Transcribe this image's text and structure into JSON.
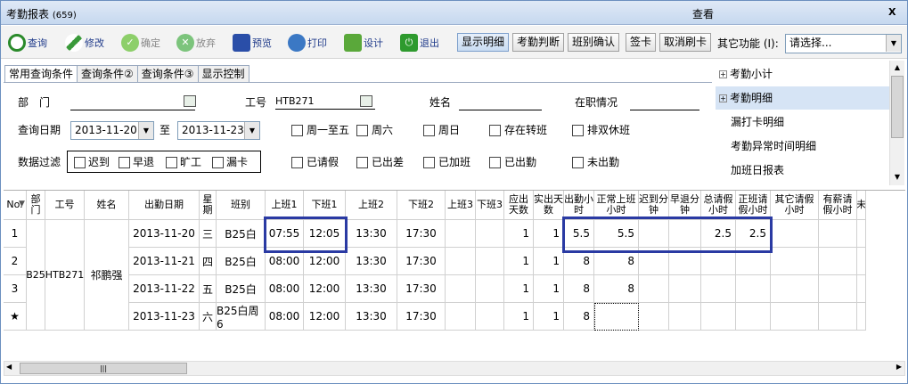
{
  "window": {
    "title": "考勤报表",
    "count": "(659)",
    "center_label": "查看",
    "close_label": "X"
  },
  "toolbar": {
    "buttons": [
      {
        "label": "查询",
        "icon": "search-icon",
        "enabled": true
      },
      {
        "label": "修改",
        "icon": "edit-icon",
        "enabled": true
      },
      {
        "label": "确定",
        "icon": "check-icon",
        "enabled": false
      },
      {
        "label": "放弃",
        "icon": "cancel-icon",
        "enabled": false
      },
      {
        "label": "预览",
        "icon": "preview-icon",
        "enabled": true
      },
      {
        "label": "打印",
        "icon": "print-icon",
        "enabled": true
      },
      {
        "label": "设计",
        "icon": "design-icon",
        "enabled": true
      },
      {
        "label": "退出",
        "icon": "exit-icon",
        "enabled": true
      }
    ],
    "actions": [
      "显示明细",
      "考勤判断",
      "班别确认",
      "签卡",
      "取消刷卡"
    ],
    "other_label": "其它功能 (I):",
    "other_value": "请选择..."
  },
  "tabs": [
    "常用查询条件",
    "查询条件②",
    "查询条件③",
    "显示控制"
  ],
  "filters": {
    "dept_label": "部　门",
    "dept_value": "",
    "emp_label": "工号",
    "emp_value": "HTB271",
    "name_label": "姓名",
    "status_label": "在职情况",
    "date_label": "查询日期",
    "date_from": "2013-11-20",
    "to_label": "至",
    "date_to": "2013-11-23",
    "check_a": [
      "周一至五",
      "周六",
      "周日",
      "存在转班",
      "排双休班"
    ],
    "filter_label": "数据过滤",
    "filter_checks": [
      "迟到",
      "早退",
      "旷工",
      "漏卡"
    ],
    "check_b": [
      "已请假",
      "已出差",
      "已加班",
      "已出勤",
      "未出勤"
    ]
  },
  "right_panel": {
    "items": [
      {
        "label": "考勤小计",
        "expandable": true,
        "selected": false
      },
      {
        "label": "考勤明细",
        "expandable": true,
        "selected": true
      },
      {
        "label": "漏打卡明细",
        "expandable": false,
        "selected": false
      },
      {
        "label": "考勤异常时间明细",
        "expandable": false,
        "selected": false
      },
      {
        "label": "加班日报表",
        "expandable": false,
        "selected": false
      }
    ]
  },
  "grid": {
    "headers": [
      "No.",
      "部门",
      "工号",
      "姓名",
      "出勤日期",
      "星期",
      "班别",
      "上班1",
      "下班1",
      "上班2",
      "下班2",
      "上班3",
      "下班3",
      "应出天数",
      "实出天数",
      "出勤小时",
      "正常上班小时",
      "迟到分钟",
      "早退分钟",
      "总请假小时",
      "正班请假小时",
      "其它请假小时",
      "有薪请假小时",
      "未"
    ],
    "group": {
      "dept": "B25",
      "emp": "HTB271",
      "name": "祁鹏强"
    },
    "rows": [
      {
        "no": "1",
        "date": "2013-11-20",
        "week": "三",
        "shift": "B25白",
        "in1": "07:55",
        "out1": "12:05",
        "in2": "13:30",
        "out2": "17:30",
        "due": "1",
        "actual": "1",
        "hours": "5.5",
        "normal": "5.5",
        "late": "",
        "early": "",
        "leave": "2.5",
        "leave_reg": "2.5"
      },
      {
        "no": "2",
        "date": "2013-11-21",
        "week": "四",
        "shift": "B25白",
        "in1": "08:00",
        "out1": "12:00",
        "in2": "13:30",
        "out2": "17:30",
        "due": "1",
        "actual": "1",
        "hours": "8",
        "normal": "8",
        "late": "",
        "early": "",
        "leave": "",
        "leave_reg": ""
      },
      {
        "no": "3",
        "date": "2013-11-22",
        "week": "五",
        "shift": "B25白",
        "in1": "08:00",
        "out1": "12:00",
        "in2": "13:30",
        "out2": "17:30",
        "due": "1",
        "actual": "1",
        "hours": "8",
        "normal": "8",
        "late": "",
        "early": "",
        "leave": "",
        "leave_reg": ""
      },
      {
        "no": "★",
        "date": "2013-11-23",
        "week": "六",
        "shift": "B25白周6",
        "in1": "08:00",
        "out1": "12:00",
        "in2": "13:30",
        "out2": "17:30",
        "due": "1",
        "actual": "1",
        "hours": "8",
        "normal": "",
        "late": "",
        "early": "",
        "leave": "",
        "leave_reg": ""
      }
    ]
  },
  "scroll": {
    "grip": "|||"
  }
}
